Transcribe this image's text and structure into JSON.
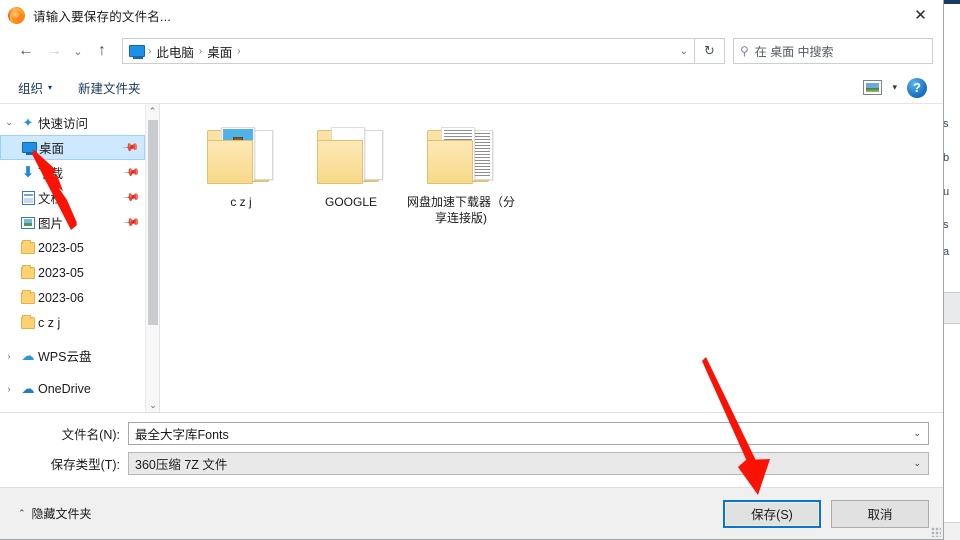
{
  "window": {
    "title": "请输入要保存的文件名...",
    "app_icon": "firefox-icon",
    "close_label": "✕"
  },
  "nav": {
    "back_icon": "←",
    "forward_icon": "→",
    "recent_icon": "⌄",
    "up_icon": "↑",
    "refresh_icon": "↻",
    "address_chevron": "⌄",
    "breadcrumb_icon": "this-pc-monitor-icon",
    "breadcrumbs": [
      "此电脑",
      "桌面"
    ],
    "separator": "›"
  },
  "search": {
    "icon": "search-icon",
    "text": "在 桌面 中搜索"
  },
  "commandbar": {
    "organize_label": "组织",
    "organize_caret": "▾",
    "new_folder_label": "新建文件夹",
    "view_icon": "view-mode-icon",
    "view_caret": "▾",
    "help_label": "?"
  },
  "sidebar": {
    "groups": [
      {
        "label": "快速访问",
        "icon": "pin-star-icon",
        "expander": "⌄",
        "expanded": true,
        "items": [
          {
            "label": "桌面",
            "icon": "desktop-icon",
            "pinned": true,
            "selected": true
          },
          {
            "label": "下载",
            "icon": "download-icon",
            "pinned": true,
            "selected": false
          },
          {
            "label": "文档",
            "icon": "documents-icon",
            "pinned": true,
            "selected": false
          },
          {
            "label": "图片",
            "icon": "pictures-icon",
            "pinned": true,
            "selected": false
          },
          {
            "label": "2023-05",
            "icon": "folder-icon",
            "pinned": false,
            "selected": false
          },
          {
            "label": "2023-05",
            "icon": "folder-icon",
            "pinned": false,
            "selected": false
          },
          {
            "label": "2023-06",
            "icon": "folder-icon",
            "pinned": false,
            "selected": false
          },
          {
            "label": "c z j",
            "icon": "folder-icon",
            "pinned": false,
            "selected": false
          }
        ]
      },
      {
        "label": "WPS云盘",
        "icon": "wps-cloud-icon",
        "expander": "›",
        "expanded": false,
        "items": []
      },
      {
        "label": "OneDrive",
        "icon": "onedrive-cloud-icon",
        "expander": "›",
        "expanded": false,
        "items": []
      }
    ],
    "scroll_up_icon": "⌃",
    "scroll_down_icon": "⌄"
  },
  "filelist": {
    "items": [
      {
        "name": "c z j",
        "thumb": "folder-preview-app"
      },
      {
        "name": "GOOGLE",
        "thumb": "folder-preview-doc"
      },
      {
        "name": "网盘加速下载器（分享连接版)",
        "thumb": "folder-preview-lines"
      }
    ]
  },
  "form": {
    "filename_label": "文件名(N):",
    "filename_value": "最全大字库Fonts",
    "filetype_label": "保存类型(T):",
    "filetype_value": "360压缩 7Z 文件",
    "caret": "⌄"
  },
  "footer": {
    "hide_folders_label": "隐藏文件夹",
    "hide_folders_caret": "⌃",
    "save_label": "保存(S)",
    "cancel_label": "取消"
  },
  "background": {
    "left_link": "u",
    "fragments": [
      "s",
      "b",
      "u",
      "s",
      "a"
    ]
  },
  "annotations": {
    "arrow_color": "#fa1205",
    "arrow_to_desktop": "points at 桌面 sidebar item",
    "arrow_to_save": "points at 保存(S) button"
  }
}
